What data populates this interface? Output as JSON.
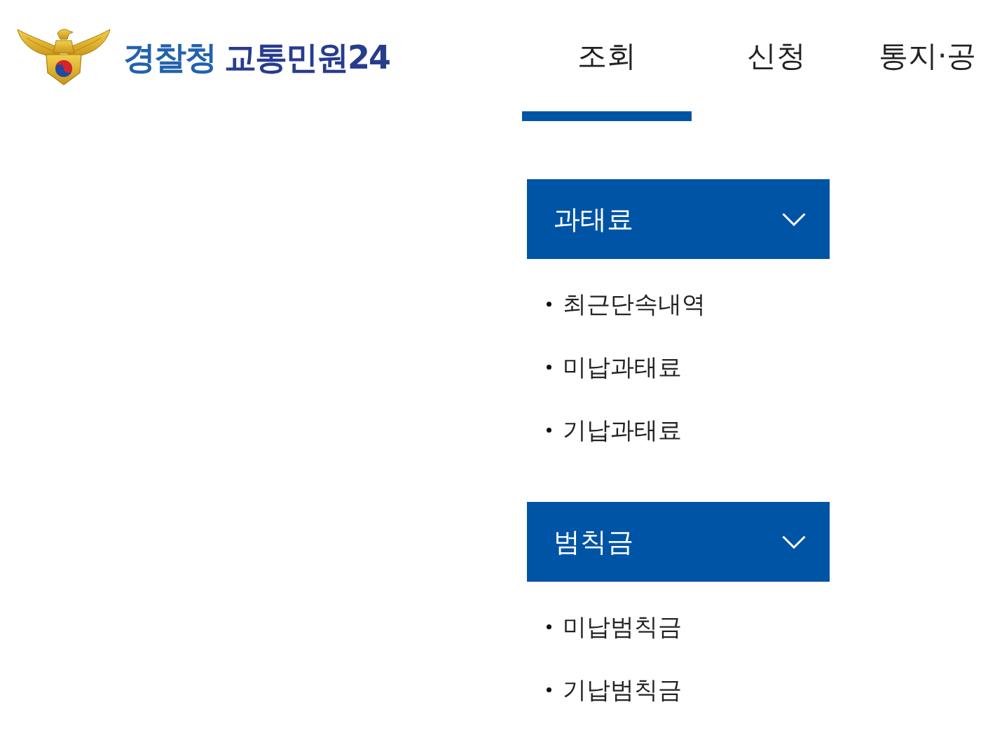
{
  "header": {
    "logo": {
      "org_name": "경찰청",
      "site_name": "교통민원24"
    }
  },
  "nav_tabs": [
    {
      "label": "조회",
      "selected": true
    },
    {
      "label": "신청",
      "selected": false
    },
    {
      "label": "통지·공",
      "selected": false
    }
  ],
  "menu_groups": [
    {
      "title": "과태료",
      "expanded": true,
      "items": [
        "최근단속내역",
        "미납과태료",
        "기납과태료"
      ]
    },
    {
      "title": "범칙금",
      "expanded": true,
      "items": [
        "미납범칙금",
        "기납범칙금"
      ]
    }
  ]
}
